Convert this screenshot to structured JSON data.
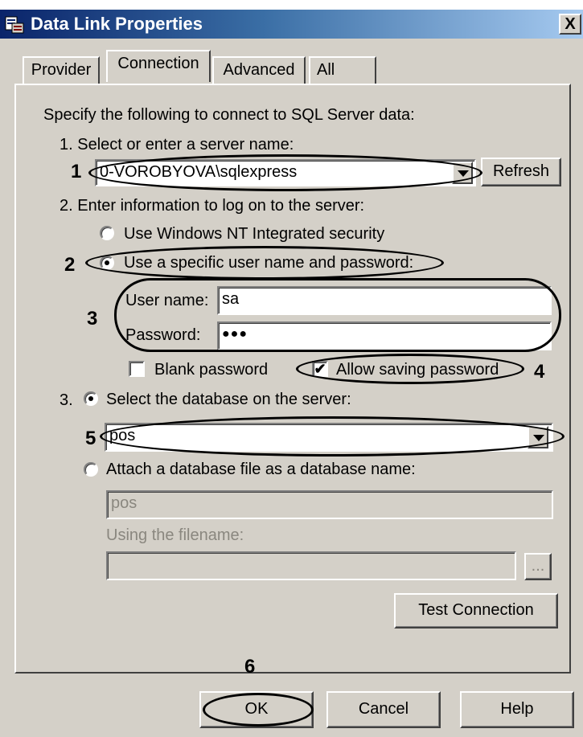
{
  "window": {
    "title": "Data Link Properties",
    "close_glyph": "X"
  },
  "tabs": [
    {
      "label": "Provider",
      "active": false
    },
    {
      "label": "Connection",
      "active": true
    },
    {
      "label": "Advanced",
      "active": false
    },
    {
      "label": "All",
      "active": false
    }
  ],
  "connection": {
    "intro": "Specify the following to connect to SQL Server data:",
    "step1_label": "1. Select or enter a server name:",
    "server_name": "0-VOROBYOVA\\sqlexpress",
    "refresh_label": "Refresh",
    "step2_label": "2. Enter information to log on to the server:",
    "option_nt": "Use Windows NT Integrated security",
    "option_specific": "Use a specific user name and password:",
    "username_label": "User name:",
    "username_value": "sa",
    "password_label": "Password:",
    "password_value": "●●●",
    "blank_password_label": "Blank password",
    "blank_password_checked": false,
    "allow_saving_label": "Allow saving password",
    "allow_saving_checked": true,
    "check_glyph": "✔",
    "step3_prefix": "3.",
    "option_select_db": "Select the database on the server:",
    "database_value": "pos",
    "option_attach": "Attach a database file as a database name:",
    "attach_name_value": "pos",
    "filename_label": "Using the filename:",
    "filename_value": "",
    "browse_label": "...",
    "test_connection_label": "Test Connection"
  },
  "footer": {
    "ok_label": "OK",
    "cancel_label": "Cancel",
    "help_label": "Help"
  },
  "annotations": {
    "n1": "1",
    "n2": "2",
    "n3": "3",
    "n4": "4",
    "n5": "5",
    "n6": "6"
  }
}
